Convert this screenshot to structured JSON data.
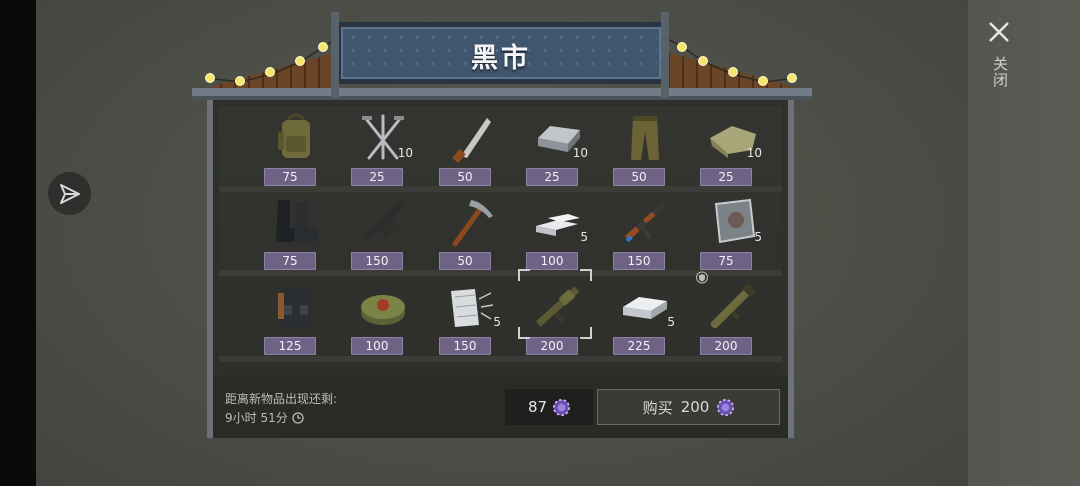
{
  "title": "黑市",
  "close_label": "关闭",
  "items": [
    {
      "icon": "backpack-icon",
      "qty": "",
      "price": "75"
    },
    {
      "icon": "nails-icon",
      "qty": "10",
      "price": "25"
    },
    {
      "icon": "machete-icon",
      "qty": "",
      "price": "50"
    },
    {
      "icon": "steel-ingot-icon",
      "qty": "10",
      "price": "25"
    },
    {
      "icon": "pants-icon",
      "qty": "",
      "price": "50"
    },
    {
      "icon": "cloth-icon",
      "qty": "10",
      "price": "25"
    },
    {
      "icon": "boots-icon",
      "qty": "",
      "price": "75"
    },
    {
      "icon": "assault-rifle-icon",
      "qty": "",
      "price": "150"
    },
    {
      "icon": "pickaxe-icon",
      "qty": "",
      "price": "50"
    },
    {
      "icon": "aluminum-bars-icon",
      "qty": "5",
      "price": "100"
    },
    {
      "icon": "ak-rifle-icon",
      "qty": "",
      "price": "150"
    },
    {
      "icon": "metal-plate-icon",
      "qty": "5",
      "price": "75"
    },
    {
      "icon": "tactical-vest-icon",
      "qty": "",
      "price": "125"
    },
    {
      "icon": "landmine-icon",
      "qty": "",
      "price": "100"
    },
    {
      "icon": "fiberglass-icon",
      "qty": "5",
      "price": "150"
    },
    {
      "icon": "grenade-launcher-icon",
      "qty": "",
      "price": "200"
    },
    {
      "icon": "silver-ingot-icon",
      "qty": "5",
      "price": "225"
    },
    {
      "icon": "bazooka-icon",
      "qty": "",
      "price": "200"
    }
  ],
  "timer": {
    "label": "距离新物品出现还剩:",
    "value": "9小时 51分"
  },
  "balance": "87",
  "buy": {
    "label": "购买",
    "price": "200"
  },
  "colors": {
    "price_tag": "#6f6385",
    "sign": "#3f566e",
    "chip": "#6b4fb0"
  }
}
